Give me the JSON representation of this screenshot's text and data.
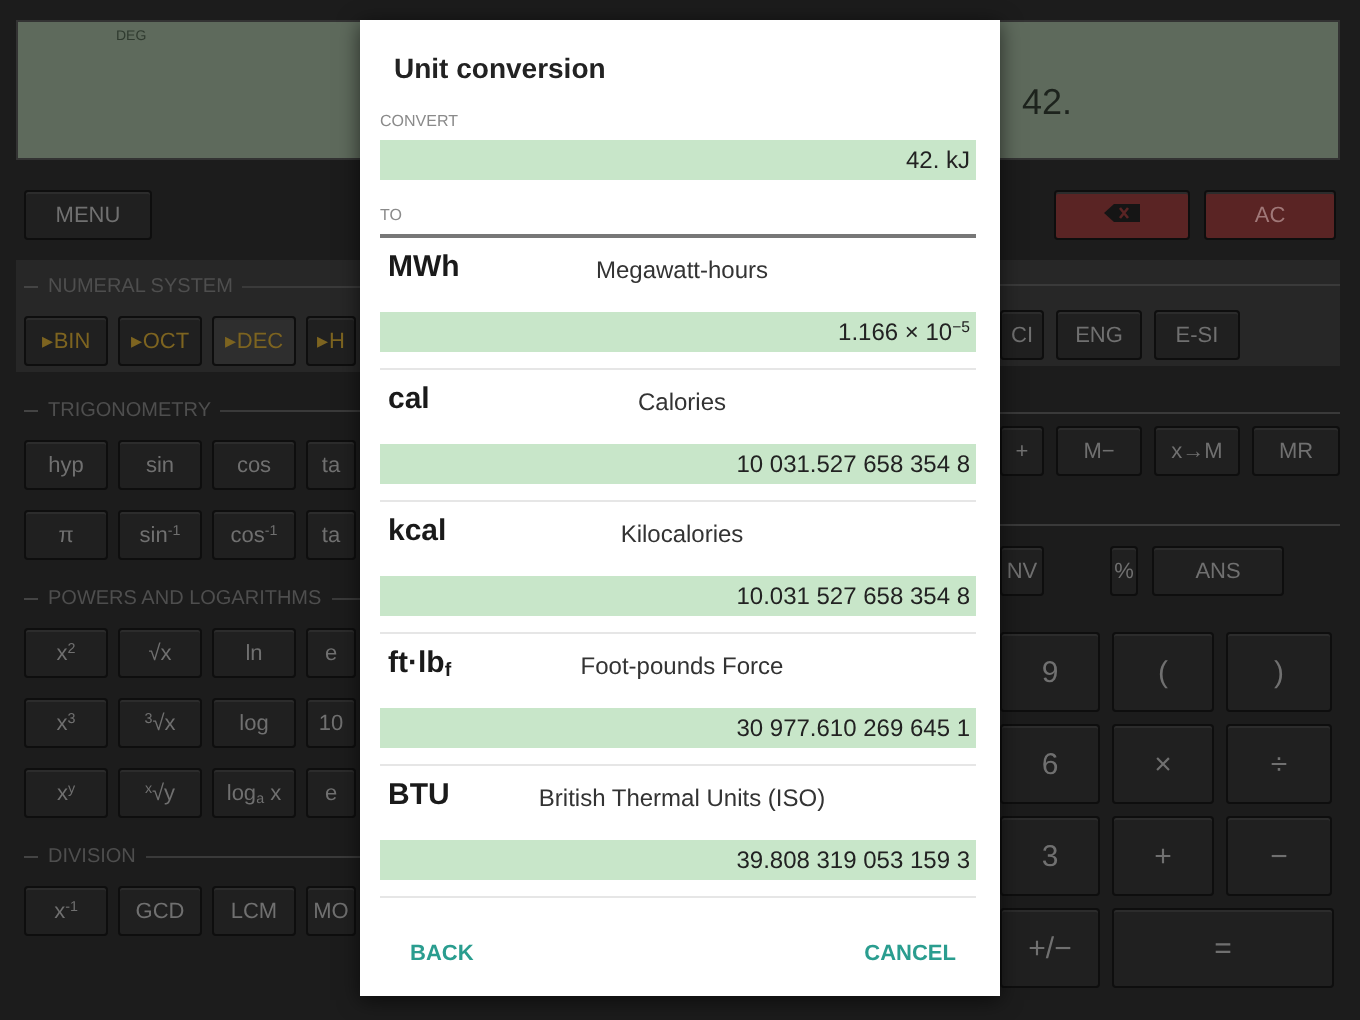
{
  "display": {
    "mode": "DEG",
    "value": "42."
  },
  "menu_button": "MENU",
  "clear_button": "AC",
  "sections": [
    {
      "title": "NUMERAL SYSTEM",
      "kind": "panel",
      "rows": [
        [
          {
            "label": "▸BIN",
            "selected": false
          },
          {
            "label": "▸OCT",
            "selected": false
          },
          {
            "label": "▸DEC",
            "selected": true
          },
          {
            "label": "▸H",
            "selected": false
          }
        ]
      ]
    },
    {
      "title": "TRIGONOMETRY",
      "kind": "plain",
      "rows": [
        [
          {
            "label": "hyp"
          },
          {
            "label": "sin"
          },
          {
            "label": "cos"
          },
          {
            "label": "ta"
          }
        ],
        [
          {
            "label": "π"
          },
          {
            "label": "sin$^{-1}$"
          },
          {
            "label": "cos$^{-1}$"
          },
          {
            "label": "ta"
          }
        ]
      ]
    },
    {
      "title": "POWERS AND LOGARITHMS",
      "kind": "plain",
      "rows": [
        [
          {
            "label": "x$^{2}$"
          },
          {
            "label": "√x"
          },
          {
            "label": "ln"
          },
          {
            "label": "e"
          }
        ],
        [
          {
            "label": "x$^{3}$"
          },
          {
            "label": "$^{3}$√x"
          },
          {
            "label": "log"
          },
          {
            "label": "10"
          }
        ],
        [
          {
            "label": "x$^{y}$"
          },
          {
            "label": "$^{x}$√y"
          },
          {
            "label": "log$_{a}$ x"
          },
          {
            "label": "e"
          }
        ]
      ]
    },
    {
      "title": "DIVISION",
      "kind": "plain",
      "rows": [
        [
          {
            "label": "x$^{-1}$"
          },
          {
            "label": "GCD"
          },
          {
            "label": "LCM"
          },
          {
            "label": "MO"
          }
        ]
      ]
    }
  ],
  "right_rows": [
    {
      "kind": "mode",
      "keys": [
        "CI",
        "ENG",
        "E-SI"
      ]
    },
    {
      "kind": "memory",
      "keys": [
        "+",
        "M−",
        "x→M",
        "MR"
      ]
    },
    {
      "kind": "function",
      "keys": [
        "NV",
        "%",
        "ANS"
      ]
    },
    {
      "kind": "digits",
      "keys": [
        "9",
        "(",
        ")"
      ]
    },
    {
      "kind": "digits",
      "keys": [
        "6",
        "×",
        "÷"
      ]
    },
    {
      "kind": "digits",
      "keys": [
        "3",
        "+",
        "−"
      ]
    },
    {
      "kind": "last",
      "keys": [
        "+/−",
        "="
      ]
    }
  ],
  "dialog": {
    "title": "Unit conversion",
    "convert_label": "CONVERT",
    "convert_value": "42. kJ",
    "to_label": "TO",
    "results": [
      {
        "symbol": "MWh",
        "name": "Megawatt-hours",
        "value": "1.166 × 10$^{−5}$"
      },
      {
        "symbol": "cal",
        "name": "Calories",
        "value": "10 031.527 658 354 8"
      },
      {
        "symbol": "kcal",
        "name": "Kilocalories",
        "value": "10.031 527 658 354 8"
      },
      {
        "symbol": "ft·lb$_{f}$",
        "name": "Foot-pounds Force",
        "value": "30 977.610 269 645 1"
      },
      {
        "symbol": "BTU",
        "name": "British Thermal Units (ISO)",
        "value": "39.808 319 053 159 3"
      }
    ],
    "buttons": [
      "BACK",
      "CANCEL"
    ]
  }
}
